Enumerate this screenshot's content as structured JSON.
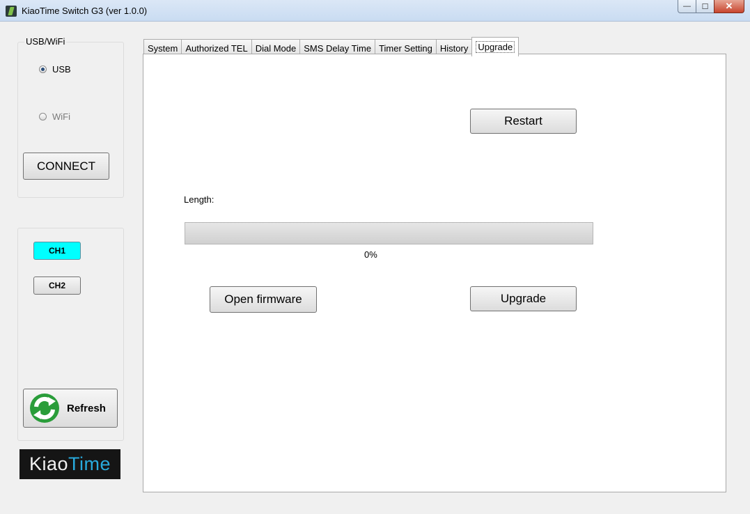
{
  "window": {
    "title": "KiaoTime Switch G3 (ver 1.0.0)"
  },
  "connection": {
    "group_title": "USB/WiFi",
    "usb_label": "USB",
    "wifi_label": "WiFi",
    "selected": "USB",
    "connect_label": "CONNECT"
  },
  "channels": [
    {
      "label": "CH1",
      "active": true,
      "color": "#00ffff"
    },
    {
      "label": "CH2",
      "active": false
    }
  ],
  "refresh_label": "Refresh",
  "logo": {
    "part1": "Kiao",
    "part2": "Time",
    "accent_color": "#28aadd"
  },
  "tabs": [
    {
      "label": "System"
    },
    {
      "label": "Authorized TEL"
    },
    {
      "label": "Dial Mode"
    },
    {
      "label": "SMS Delay Time"
    },
    {
      "label": "Timer Setting"
    },
    {
      "label": "History"
    },
    {
      "label": "Upgrade",
      "active": true
    }
  ],
  "upgrade": {
    "restart_label": "Restart",
    "length_label": "Length:",
    "progress_percent": 0,
    "progress_text": "0%",
    "open_firmware_label": "Open firmware",
    "upgrade_label": "Upgrade"
  }
}
